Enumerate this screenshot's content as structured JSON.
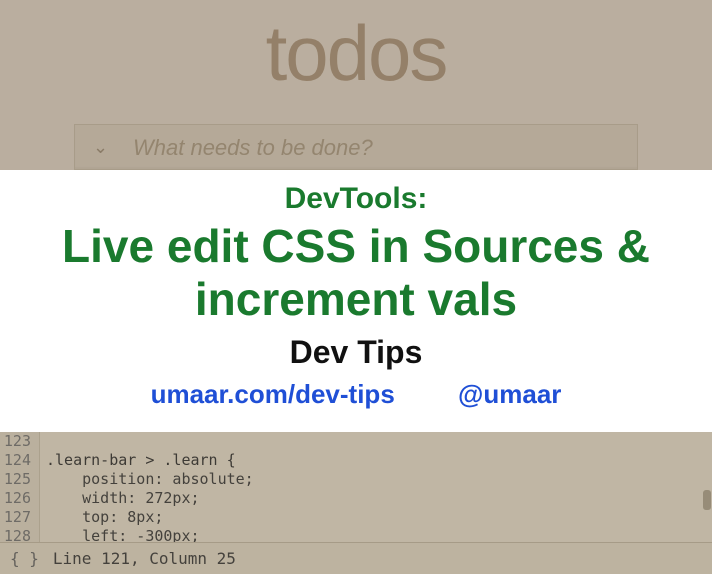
{
  "app": {
    "title": "todos",
    "input_placeholder": "What needs to be done?"
  },
  "banner": {
    "kicker": "DevTools:",
    "headline": "Live edit CSS in Sources & increment vals",
    "sub": "Dev Tips",
    "link_site": "umaar.com/dev-tips",
    "link_handle": "@umaar"
  },
  "code": {
    "lines": [
      {
        "num": "123",
        "text": ""
      },
      {
        "num": "124",
        "text": ".learn-bar > .learn {"
      },
      {
        "num": "125",
        "text": "    position: absolute;"
      },
      {
        "num": "126",
        "text": "    width: 272px;"
      },
      {
        "num": "127",
        "text": "    top: 8px;"
      },
      {
        "num": "128",
        "text": "    left: -300px;"
      }
    ]
  },
  "status": {
    "icon": "{ }",
    "text": "Line 121, Column 25"
  }
}
